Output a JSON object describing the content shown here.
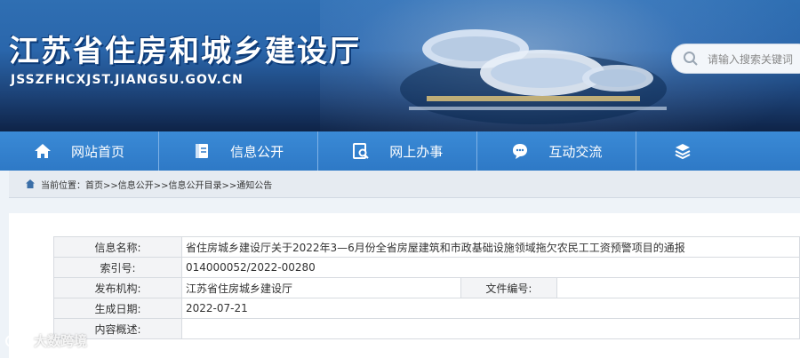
{
  "header": {
    "title": "江苏省住房和城乡建设厅",
    "url": "JSSZFHCXJST.JIANGSU.GOV.CN",
    "search_placeholder": "请输入搜索关键词"
  },
  "nav": {
    "items": [
      {
        "label": "网站首页",
        "icon": "home-icon"
      },
      {
        "label": "信息公开",
        "icon": "document-icon"
      },
      {
        "label": "网上办事",
        "icon": "search-doc-icon"
      },
      {
        "label": "互动交流",
        "icon": "chat-icon"
      },
      {
        "label": "",
        "icon": "layers-icon"
      }
    ]
  },
  "breadcrumb": {
    "prefix": "当前位置：",
    "path": "首页>>信息公开>>信息公开目录>>通知公告"
  },
  "info": {
    "name_label": "信息名称:",
    "name_value": "省住房城乡建设厅关于2022年3—6月份全省房屋建筑和市政基础设施领域拖欠农民工工资预警项目的通报",
    "index_label": "索引号:",
    "index_value": "014000052/2022-00280",
    "publisher_label": "发布机构:",
    "publisher_value": "江苏省住房城乡建设厅",
    "docno_label": "文件编号:",
    "docno_value": "",
    "date_label": "生成日期:",
    "date_value": "2022-07-21",
    "summary_label": "内容概述:",
    "summary_value": ""
  },
  "watermark": {
    "text": "大数跨境"
  },
  "colors": {
    "nav_bg": "#2e79c6",
    "header_bg": "#2a66ab",
    "table_border": "#d7dbe0"
  }
}
